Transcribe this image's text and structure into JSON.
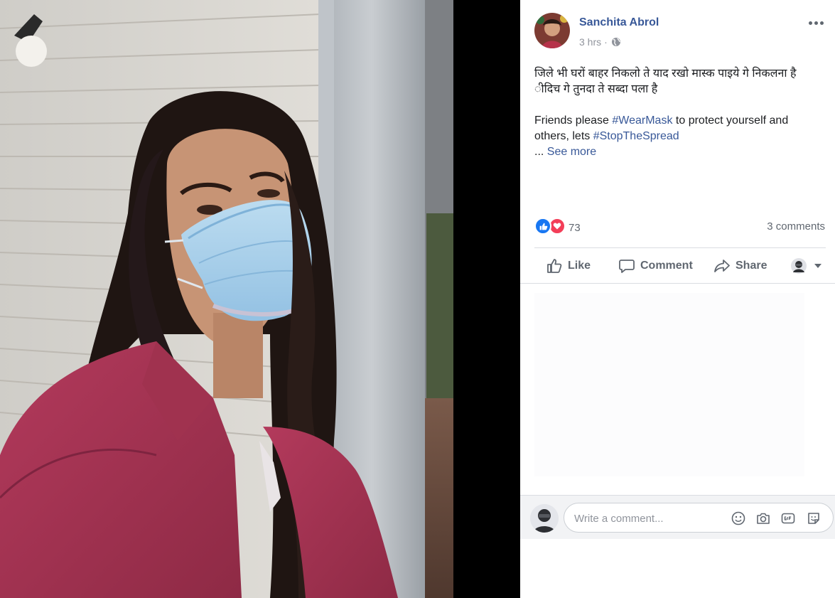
{
  "post": {
    "author": "Sanchita Abrol",
    "time": "3 hrs",
    "separator": "·",
    "audience_icon": "globe-icon",
    "menu_icon": "more-horizontal-icon",
    "text_line1": "जिले भी घरों बाहर निकलो ते याद रखो मास्क पाइये गे निकलना है",
    "text_line2": "ीदिच गे तुनदा ते सब्दा पला है",
    "text_line3_prefix": "Friends please ",
    "hashtag1": "#WearMask",
    "text_line3_mid": " to protect yourself and others, lets ",
    "hashtag2": "#StopTheSpread",
    "ellipsis": "... ",
    "see_more": "See more"
  },
  "reactions": {
    "count": "73",
    "icons": [
      "like-reaction-icon",
      "love-reaction-icon"
    ],
    "comments": "3 comments"
  },
  "actions": {
    "like": "Like",
    "comment": "Comment",
    "share": "Share"
  },
  "comment_box": {
    "placeholder": "Write a comment...",
    "icons": [
      "emoji-icon",
      "camera-icon",
      "gif-icon",
      "sticker-icon"
    ]
  },
  "colors": {
    "link_blue": "#385898",
    "like_blue": "#1877f2",
    "love_red": "#f33e58",
    "secondary_text": "#606770"
  }
}
